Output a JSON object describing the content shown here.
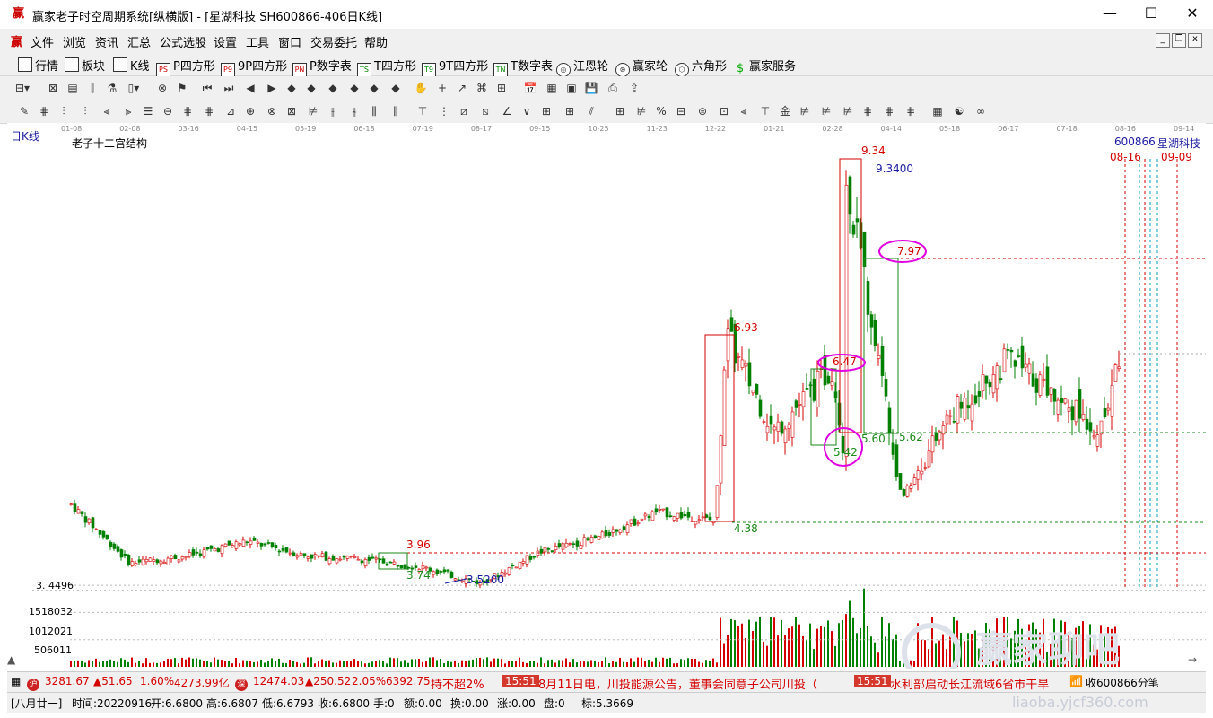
{
  "window": {
    "title": "赢家老子时空周期系统[纵横版] - [星湖科技  SH600866-406日K线]",
    "minimize": "—",
    "maximize": "☐",
    "close": "✕"
  },
  "menu": {
    "items": [
      "文件",
      "浏览",
      "资讯",
      "汇总",
      "公式选股",
      "设置",
      "工具",
      "窗口",
      "交易委托",
      "帮助"
    ],
    "mdi": [
      "_",
      "❐",
      "x"
    ]
  },
  "toolbar": {
    "items": [
      {
        "label": "行情",
        "icon": "quote-table-icon"
      },
      {
        "label": "板块",
        "icon": "sector-icon"
      },
      {
        "label": "K线",
        "icon": "kline-icon"
      },
      {
        "label": "P四方形",
        "icon": "p-square-icon"
      },
      {
        "label": "9P四方形",
        "icon": "9p-square-icon"
      },
      {
        "label": "P数字表",
        "icon": "p-number-table-icon"
      },
      {
        "label": "T四方形",
        "icon": "t-square-icon"
      },
      {
        "label": "9T四方形",
        "icon": "9t-square-icon"
      },
      {
        "label": "T数字表",
        "icon": "t-number-table-icon"
      },
      {
        "label": "江恩轮",
        "icon": "gann-wheel-icon"
      },
      {
        "label": "赢家轮",
        "icon": "winner-wheel-icon"
      },
      {
        "label": "六角形",
        "icon": "hexagon-icon"
      },
      {
        "label": "赢家服务",
        "icon": "service-icon"
      }
    ]
  },
  "chart": {
    "period_label": "日K线",
    "indicator_title": "老子十二宫结构",
    "stock_code": "600866",
    "stock_name": "星湖科技",
    "date_marks": "08-16",
    "date_marks2": "09-09",
    "low_label": "3. 4496",
    "vol_labels": [
      "1518032",
      "1012021",
      "506011"
    ],
    "price_annotations": {
      "p934": "9.34",
      "p93400": "9.3400",
      "p797": "7.97",
      "p693": "6.93",
      "p647": "6.47",
      "p560": "5.60",
      "p562": "5.62",
      "p542": "5.42",
      "p438": "4.38",
      "p396": "3.96",
      "p374": "3.74",
      "p35200": "3.5200"
    }
  },
  "chart_data": {
    "type": "candlestick",
    "title": "老子十二宫结构",
    "x_tick_labels": [
      "01-08",
      "02-08",
      "03-16",
      "04-15",
      "05-19",
      "06-18",
      "07-19",
      "08-17",
      "09-15",
      "10-25",
      "11-23",
      "12-22",
      "01-21",
      "02-28",
      "04-14",
      "05-18",
      "06-17",
      "07-18",
      "08-16",
      "09-14"
    ],
    "price_key_points": [
      {
        "x": "01-08",
        "y": 4.6
      },
      {
        "x": "02-08",
        "y": 3.8
      },
      {
        "x": "03-16",
        "y": 3.9
      },
      {
        "x": "04-15",
        "y": 4.1
      },
      {
        "x": "05-19",
        "y": 3.9
      },
      {
        "x": "06-18",
        "y": 3.85
      },
      {
        "x": "07-19",
        "y": 3.74
      },
      {
        "x": "08-17",
        "y": 3.52
      },
      {
        "x": "09-15",
        "y": 3.95
      },
      {
        "x": "10-25",
        "y": 4.15
      },
      {
        "x": "11-23",
        "y": 4.5
      },
      {
        "x": "12-22",
        "y": 4.38
      },
      {
        "x": "12-22",
        "y": 6.93
      },
      {
        "x": "01-21",
        "y": 5.6
      },
      {
        "x": "02-28",
        "y": 6.47
      },
      {
        "x": "02-28",
        "y": 5.42
      },
      {
        "x": "02-28",
        "y": 9.34
      },
      {
        "x": "04-14",
        "y": 5.62
      },
      {
        "x": "04-14",
        "y": 4.7
      },
      {
        "x": "05-18",
        "y": 5.8
      },
      {
        "x": "06-17",
        "y": 6.6
      },
      {
        "x": "07-18",
        "y": 6.0
      },
      {
        "x": "08-16",
        "y": 5.6
      },
      {
        "x": "08-16",
        "y": 6.68
      }
    ],
    "horizontal_levels": [
      7.97,
      5.6,
      4.38,
      3.96
    ],
    "volume_axis_ticks": [
      1518032,
      1012021,
      506011
    ],
    "last_bar": {
      "time": "20220916",
      "open": 6.68,
      "high": 6.6807,
      "low": 6.6793,
      "close": 6.68
    }
  },
  "ticker": {
    "sh_index": "3281.67",
    "sh_change": "▲51.65",
    "sh_pct": "1.60%",
    "sh_amount": "4273.99亿",
    "sz_index": "12474.03",
    "sz_change": "▲250.52",
    "sz_pct": "2.05%",
    "sz_amount": "6392.75",
    "news_tail": "持不超2%",
    "time1": "15:51",
    "news1": "8月11日电，川投能源公告，董事会同意子公司川投（",
    "time2": "15:51",
    "news2": "水利部启动长江流域6省市干旱",
    "close_label": "收600866分笔"
  },
  "status": {
    "lunar": "[八月廿一]",
    "time": "时间:20220916",
    "open": "开:6.6800",
    "high": "高:6.6807",
    "low": "低:6.6793",
    "close": "收:6.6800",
    "hand": "手:0",
    "amount": "额:0.00",
    "turnover": "换:0.00",
    "change": "涨:0.00",
    "pan": "盘:0",
    "mark": "标:5.3669"
  },
  "watermark": {
    "text1": "赢家聊吧",
    "text2": "liaoba.yjcf360.com"
  },
  "colors": {
    "up": "#d40000",
    "down": "#008000",
    "annot_red": "#d40000",
    "annot_green": "#1a8a1a",
    "annot_blue": "#1a1aa0",
    "magenta": "#e000e0",
    "cyan": "#00a0c0"
  }
}
